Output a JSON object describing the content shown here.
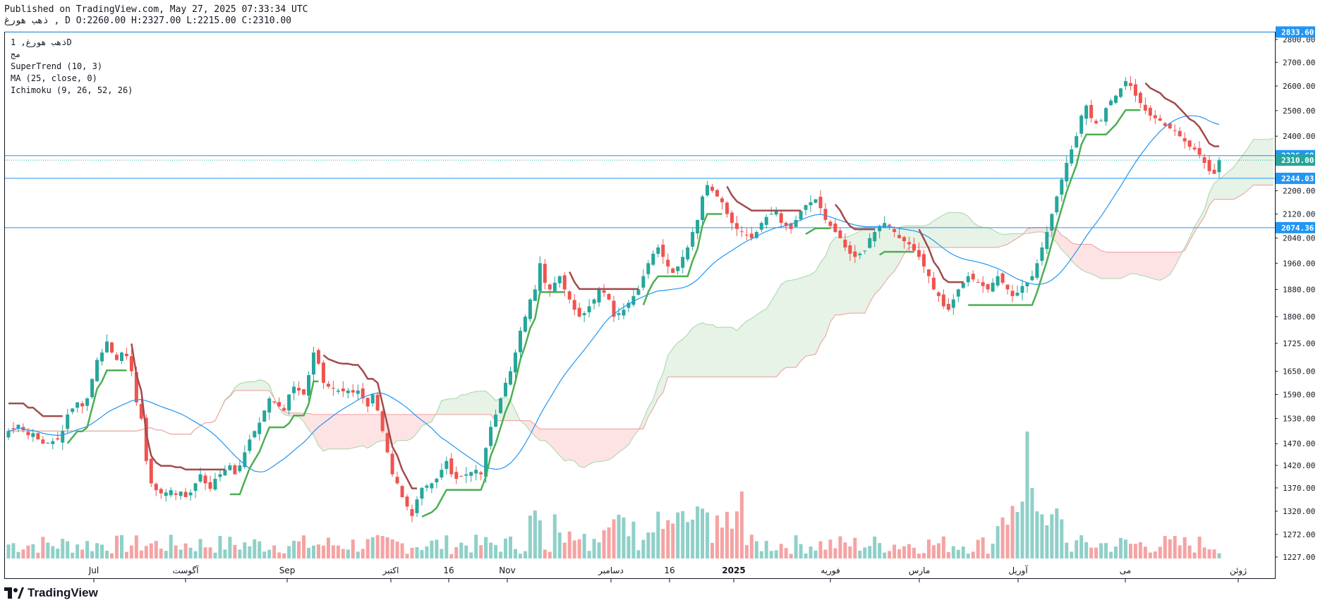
{
  "header": {
    "published": "Published on TradingView.com, May 27, 2025 07:33:34 UTC",
    "ohlc_line": "ذهب هورغ , D O:2260.00 H:2327.00 L:2215.00 C:2310.00"
  },
  "legend": {
    "symbol": "ذهب هورغ, 1D",
    "exchange": "مج",
    "ind1": "SuperTrend (10, 3)",
    "ind2": "MA (25, close, 0)",
    "ind3": "Ichimoku (9, 26, 52, 26)"
  },
  "brand": {
    "name": "TradingView",
    "icon": "tradingview-logo-icon"
  },
  "colors": {
    "up": "#26a69a",
    "down": "#ef5350",
    "up_vol": "#8fd0c8",
    "down_vol": "#f5a3a3",
    "supertrend_up": "#4caf50",
    "supertrend_down": "#a34a4a",
    "ma": "#2196f3",
    "hline": "#2196f3",
    "cloud_green": "#e6f3e6",
    "cloud_red": "#fde3e3",
    "span_a": "#a5d6a7",
    "span_b": "#ef9a9a",
    "label_green": "#26a69a"
  },
  "chart_data": {
    "type": "candlestick",
    "scale": "log",
    "y_ticks": [
      "2800.00",
      "2700.00",
      "2600.00",
      "2500.00",
      "2400.00",
      "2200.00",
      "2120.00",
      "2040.00",
      "1960.00",
      "1880.00",
      "1800.00",
      "1725.00",
      "1650.00",
      "1590.00",
      "1530.00",
      "1470.00",
      "1420.00",
      "1370.00",
      "1320.00",
      "1272.00",
      "1227.00"
    ],
    "x_labels": [
      "Jul",
      "آگوست",
      "Sep",
      "اکتبر",
      "16",
      "Nov",
      "دسامبر",
      "16",
      "2025",
      "فوریه",
      "مارس",
      "آوریل",
      "می",
      "ژوئن"
    ],
    "price_labels": [
      {
        "text": "2833.60",
        "value": 2833.6,
        "kind": "hline"
      },
      {
        "text": "2326.68",
        "value": 2326.68,
        "kind": "hline"
      },
      {
        "text": "2310.00",
        "value": 2310.0,
        "kind": "last"
      },
      {
        "text": "2244.03",
        "value": 2244.03,
        "kind": "hline"
      },
      {
        "text": "2074.36",
        "value": 2074.36,
        "kind": "hline"
      }
    ],
    "closes": [
      1500,
      1505,
      1515,
      1502,
      1490,
      1495,
      1480,
      1470,
      1472,
      1476,
      1480,
      1500,
      1540,
      1555,
      1570,
      1560,
      1580,
      1630,
      1680,
      1700,
      1730,
      1700,
      1680,
      1700,
      1690,
      1650,
      1570,
      1530,
      1430,
      1380,
      1365,
      1358,
      1360,
      1365,
      1355,
      1362,
      1350,
      1360,
      1380,
      1400,
      1380,
      1368,
      1390,
      1400,
      1410,
      1420,
      1400,
      1420,
      1450,
      1480,
      1500,
      1520,
      1550,
      1580,
      1570,
      1560,
      1550,
      1590,
      1610,
      1600,
      1590,
      1640,
      1700,
      1670,
      1620,
      1610,
      1605,
      1600,
      1598,
      1600,
      1595,
      1600,
      1580,
      1560,
      1590,
      1550,
      1500,
      1450,
      1400,
      1380,
      1350,
      1330,
      1310,
      1345,
      1370,
      1375,
      1380,
      1390,
      1410,
      1430,
      1400,
      1390,
      1395,
      1400,
      1405,
      1410,
      1400,
      1460,
      1510,
      1540,
      1580,
      1620,
      1650,
      1700,
      1760,
      1800,
      1850,
      1880,
      1960,
      1900,
      1880,
      1900,
      1920,
      1880,
      1850,
      1820,
      1800,
      1810,
      1830,
      1850,
      1880,
      1870,
      1850,
      1800,
      1810,
      1820,
      1840,
      1860,
      1880,
      1920,
      1960,
      1990,
      2010,
      1980,
      1950,
      1930,
      1950,
      1980,
      2010,
      2060,
      2100,
      2180,
      2220,
      2200,
      2180,
      2160,
      2120,
      2090,
      2070,
      2060,
      2050,
      2040,
      2060,
      2090,
      2110,
      2120,
      2130,
      2090,
      2080,
      2070,
      2100,
      2130,
      2150,
      2160,
      2170,
      2140,
      2100,
      2080,
      2060,
      2040,
      2010,
      1990,
      1980,
      1990,
      2000,
      2040,
      2060,
      2080,
      2090,
      2080,
      2060,
      2040,
      2030,
      2020,
      2000,
      1980,
      1950,
      1920,
      1880,
      1860,
      1830,
      1820,
      1850,
      1880,
      1900,
      1920,
      1910,
      1900,
      1890,
      1880,
      1900,
      1920,
      1900,
      1880,
      1860,
      1870,
      1890,
      1900,
      1920,
      1960,
      2010,
      2060,
      2120,
      2180,
      2240,
      2300,
      2350,
      2400,
      2480,
      2520,
      2470,
      2450,
      2460,
      2510,
      2540,
      2560,
      2590,
      2620,
      2600,
      2560,
      2530,
      2500,
      2480,
      2470,
      2460,
      2440,
      2430,
      2420,
      2400,
      2380,
      2360,
      2350,
      2330,
      2300,
      2270,
      2260,
      2310
    ],
    "volume_peak_note": "tallest volume bar in late April"
  }
}
